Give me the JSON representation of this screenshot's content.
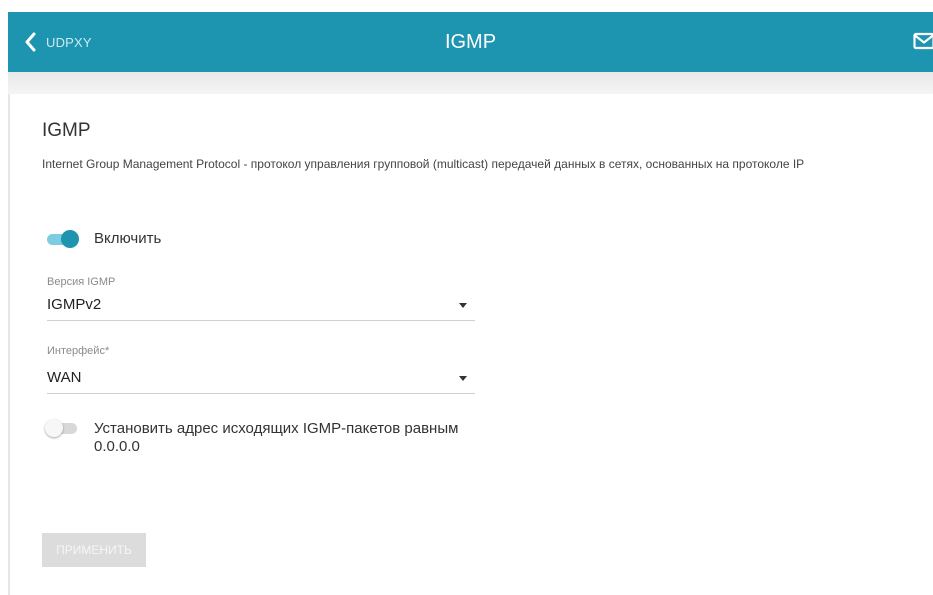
{
  "header": {
    "back_label": "UDPXY",
    "title": "IGMP"
  },
  "content": {
    "heading": "IGMP",
    "description": "Internet Group Management Protocol - протокол управления групповой (multicast) передачей данных в сетях, основанных на протоколе IP"
  },
  "enable_toggle": {
    "label": "Включить",
    "checked": true
  },
  "igmp_version": {
    "label": "Версия IGMP",
    "value": "IGMPv2"
  },
  "interface": {
    "label": "Интерфейс*",
    "value": "WAN"
  },
  "zero_address_toggle": {
    "label": "Установить адрес исходящих IGMP-пакетов равным 0.0.0.0",
    "checked": false
  },
  "apply_button": {
    "label": "ПРИМЕНИТЬ",
    "enabled": false
  },
  "colors": {
    "header_bg": "#1d95b0",
    "toggle_on": "#1d95b0",
    "toggle_on_track": "#7dcde0",
    "disabled_button": "#dcdcdc"
  },
  "icons": [
    "chevron-left-icon",
    "mail-icon",
    "caret-down-icon"
  ]
}
